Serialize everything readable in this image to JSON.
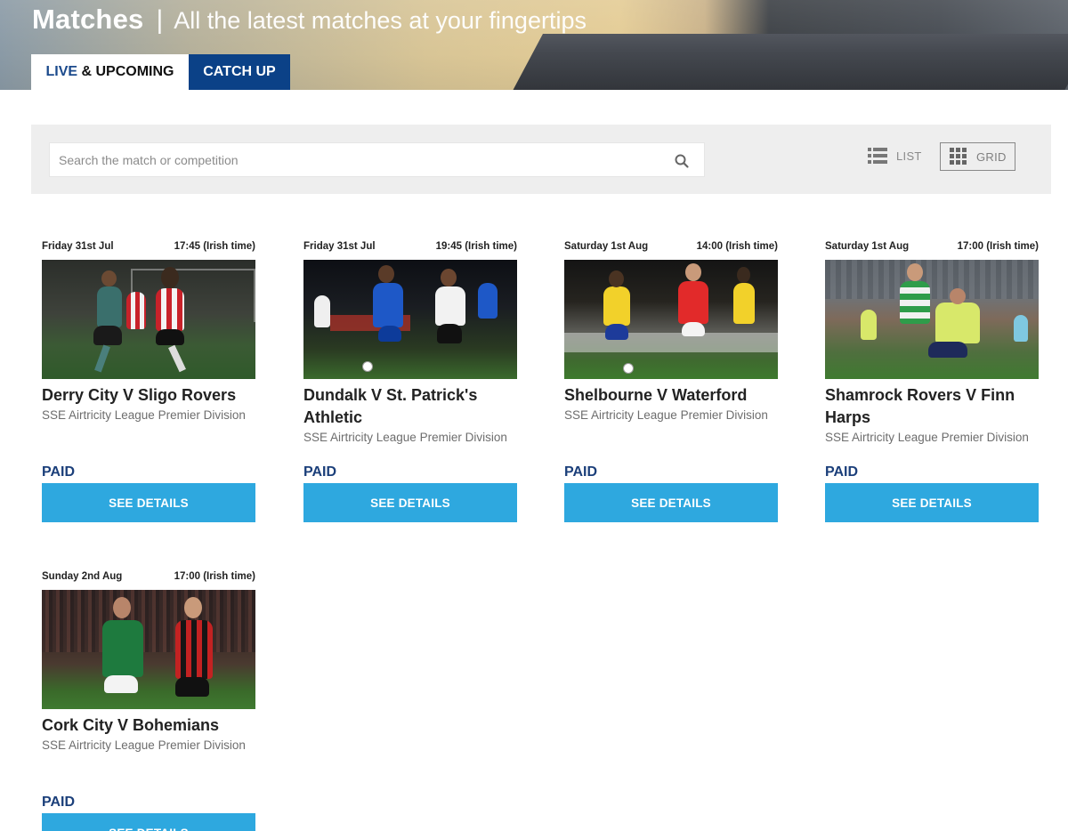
{
  "header": {
    "title": "Matches",
    "separator": "|",
    "subtitle": "All the latest matches at your fingertips",
    "tabs": {
      "live_highlight": "LIVE",
      "live_rest": " & UPCOMING",
      "catchup": "CATCH UP"
    }
  },
  "toolbar": {
    "search_placeholder": "Search the match or competition",
    "list_label": "LIST",
    "grid_label": "GRID"
  },
  "matches": [
    {
      "date": "Friday 31st Jul",
      "time": "17:45 (Irish time)",
      "name": "Derry City V Sligo Rovers",
      "competition": "SSE Airtricity League Premier Division",
      "price": "PAID",
      "button": "SEE DETAILS"
    },
    {
      "date": "Friday 31st Jul",
      "time": "19:45 (Irish time)",
      "name": "Dundalk V St. Patrick's Athletic",
      "competition": "SSE Airtricity League Premier Division",
      "price": "PAID",
      "button": "SEE DETAILS"
    },
    {
      "date": "Saturday 1st Aug",
      "time": "14:00 (Irish time)",
      "name": "Shelbourne V Waterford",
      "competition": "SSE Airtricity League Premier Division",
      "price": "PAID",
      "button": "SEE DETAILS"
    },
    {
      "date": "Saturday 1st Aug",
      "time": "17:00 (Irish time)",
      "name": "Shamrock Rovers V Finn Harps",
      "competition": "SSE Airtricity League Premier Division",
      "price": "PAID",
      "button": "SEE DETAILS"
    },
    {
      "date": "Sunday 2nd Aug",
      "time": "17:00 (Irish time)",
      "name": "Cork City V Bohemians",
      "competition": "SSE Airtricity League Premier Division",
      "price": "PAID",
      "button": "SEE DETAILS"
    }
  ],
  "colors": {
    "tab_active_text": "#1b4a8c",
    "tab_inactive_bg": "#0b4187",
    "paid_text": "#1b3f7a",
    "button_bg": "#2ea8df"
  }
}
